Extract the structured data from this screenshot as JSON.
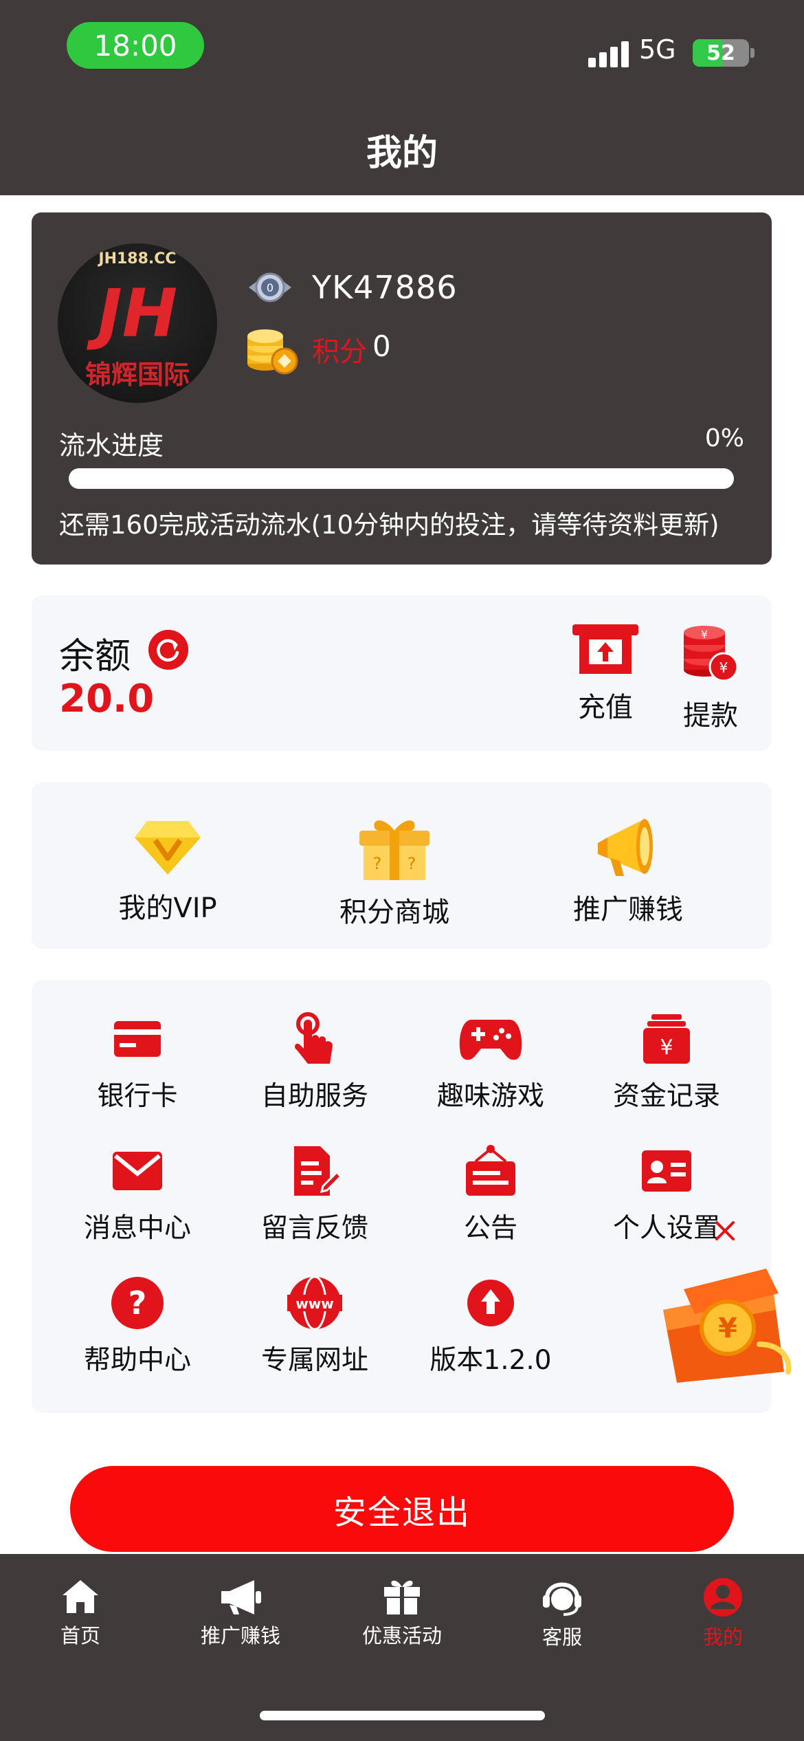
{
  "status_bar": {
    "time": "18:00",
    "network": "5G",
    "battery": "52",
    "battery_level": 0.52
  },
  "header": {
    "title": "我的"
  },
  "profile": {
    "avatar_domain": "JH188.CC",
    "avatar_mark": "JH",
    "avatar_brand": "锦辉国际",
    "level": "0",
    "username": "YK47886",
    "points_label": "积分",
    "points_value": "0",
    "progress_label": "流水进度",
    "progress_percent": "0%",
    "progress_fraction": 0,
    "progress_note": "还需160完成活动流水(10分钟内的投注，请等待资料更新)"
  },
  "balance": {
    "label": "余额",
    "value": "20.0",
    "recharge_label": "充值",
    "withdraw_label": "提款"
  },
  "features": [
    {
      "label": "我的VIP",
      "icon": "vip-diamond-icon"
    },
    {
      "label": "积分商城",
      "icon": "points-mall-gift-icon"
    },
    {
      "label": "推广赚钱",
      "icon": "megaphone-icon"
    }
  ],
  "grid": [
    {
      "label": "银行卡",
      "icon": "bank-card-icon"
    },
    {
      "label": "自助服务",
      "icon": "touch-hand-icon"
    },
    {
      "label": "趣味游戏",
      "icon": "gamepad-icon"
    },
    {
      "label": "资金记录",
      "icon": "fund-record-icon"
    },
    {
      "label": "消息中心",
      "icon": "mail-icon"
    },
    {
      "label": "留言反馈",
      "icon": "feedback-icon"
    },
    {
      "label": "公告",
      "icon": "notice-board-icon"
    },
    {
      "label": "个人设置",
      "icon": "id-card-icon"
    },
    {
      "label": "帮助中心",
      "icon": "help-icon"
    },
    {
      "label": "专属网址",
      "icon": "www-icon"
    },
    {
      "label": "版本1.2.0",
      "icon": "upgrade-icon"
    }
  ],
  "logout": {
    "label": "安全退出"
  },
  "tabbar": [
    {
      "label": "首页",
      "icon": "home-icon"
    },
    {
      "label": "推广赚钱",
      "icon": "megaphone-icon"
    },
    {
      "label": "优惠活动",
      "icon": "gift-icon"
    },
    {
      "label": "客服",
      "icon": "headset-icon"
    },
    {
      "label": "我的",
      "icon": "user-icon",
      "active": true
    }
  ],
  "colors": {
    "accent": "#e0141a",
    "dark": "#403b3a",
    "card": "#f6f7fb",
    "status_pill": "#2fc83f"
  }
}
